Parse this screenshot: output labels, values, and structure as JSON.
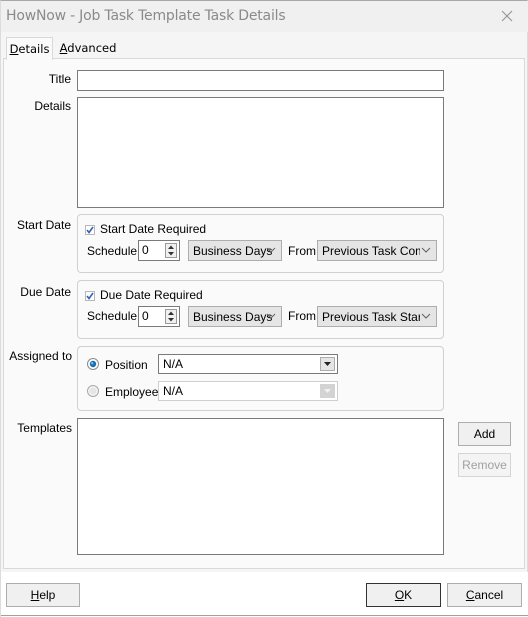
{
  "window": {
    "title": "HowNow - Job Task Template Task Details"
  },
  "tabs": [
    {
      "label_first": "D",
      "label_rest": "etails",
      "active": true
    },
    {
      "label_first": "A",
      "label_rest": "dvanced",
      "active": false
    }
  ],
  "form": {
    "title_label": "Title",
    "title_value": "",
    "details_label": "Details",
    "details_value": "",
    "start_date": {
      "label": "Start Date",
      "required_label": "Start Date Required",
      "required_checked": true,
      "schedule_label": "Schedule",
      "schedule_value": "0",
      "unit": "Business Days",
      "from_label": "From",
      "from_value": "Previous Task Comp"
    },
    "due_date": {
      "label": "Due Date",
      "required_label": "Due Date Required",
      "required_checked": true,
      "schedule_label": "Schedule",
      "schedule_value": "0",
      "unit": "Business Days",
      "from_label": "From",
      "from_value": "Previous Task Start"
    },
    "assigned_to": {
      "label": "Assigned to",
      "position_label": "Position",
      "position_selected": true,
      "position_value": "N/A",
      "employee_label": "Employee",
      "employee_selected": false,
      "employee_value": "N/A"
    },
    "templates": {
      "label": "Templates",
      "items": [],
      "add_label": "Add",
      "remove_label": "Remove"
    }
  },
  "footer": {
    "help_first": "H",
    "help_rest": "elp",
    "ok_first": "O",
    "ok_rest": "K",
    "cancel_first": "C",
    "cancel_rest": "ancel"
  }
}
